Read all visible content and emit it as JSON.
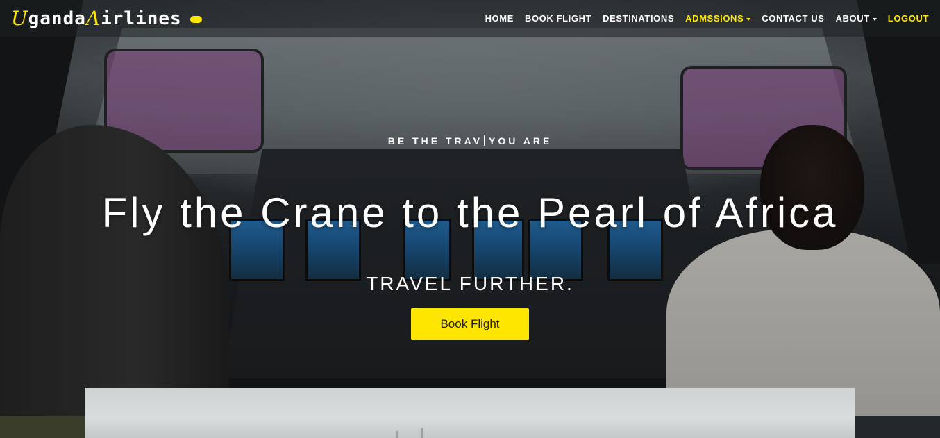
{
  "brand": {
    "accent_1": "U",
    "text_1": "ganda",
    "accent_2": "Λ",
    "text_2": "irlines",
    "accent_color": "#ffe600"
  },
  "nav": {
    "items": [
      {
        "label": "HOME",
        "active": false,
        "dropdown": false
      },
      {
        "label": "BOOK FLIGHT",
        "active": false,
        "dropdown": false
      },
      {
        "label": "DESTINATIONS",
        "active": false,
        "dropdown": false
      },
      {
        "label": "ADMSSIONS",
        "active": true,
        "dropdown": true
      },
      {
        "label": "CONTACT US",
        "active": false,
        "dropdown": false
      },
      {
        "label": "ABOUT",
        "active": false,
        "dropdown": true
      },
      {
        "label": "LOGOUT",
        "active": true,
        "dropdown": false
      }
    ]
  },
  "hero": {
    "kicker_before": "BE THE TRAV",
    "kicker_after": "YOU ARE",
    "headline": "Fly the Crane to the Pearl of Africa",
    "tagline": "TRAVEL FURTHER.",
    "cta_label": "Book Flight",
    "cta_color": "#ffe600"
  }
}
